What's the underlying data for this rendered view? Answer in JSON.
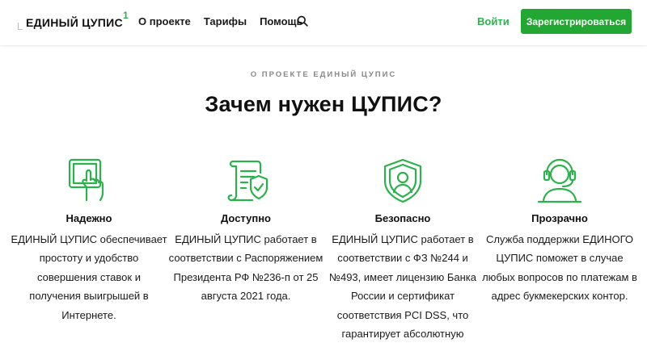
{
  "header": {
    "logo_text": "ЕДИНЫЙ ЦУПИС",
    "logo_sup": "1",
    "nav": [
      "О проекте",
      "Тарифы",
      "Помощь"
    ],
    "search_icon": "search-icon",
    "login_label": "Войти",
    "register_label": "Зарегистрироваться"
  },
  "section": {
    "overline": "О ПРОЕКТЕ ЕДИНЫЙ ЦУПИС",
    "title": "Зачем нужен ЦУПИС?"
  },
  "features": [
    {
      "icon": "tablet-touch-icon",
      "title": "Надежно",
      "text": "ЕДИНЫЙ ЦУПИС обеспечивает простоту и удобство совершения ставок и получения выигрышей в Интернете."
    },
    {
      "icon": "document-shield-icon",
      "title": "Доступно",
      "text": "ЕДИНЫЙ ЦУПИС работает в соответствии с Распоряжением Президента РФ №236-п от 25 августа 2021 года."
    },
    {
      "icon": "shield-person-icon",
      "title": "Безопасно",
      "text": "ЕДИНЫЙ ЦУПИС работает в соответствии с ФЗ №244 и №493, имеет лицензию Банка России и сертификат соответствия PCI DSS, что гарантирует абсолютную"
    },
    {
      "icon": "headset-support-icon",
      "title": "Прозрачно",
      "text": "Служба поддержки ЕДИНОГО ЦУПИС поможет в случае любых вопросов по платежам в адрес букмекерских контор."
    }
  ],
  "colors": {
    "accent": "#2bb24c",
    "button": "#22a832"
  }
}
